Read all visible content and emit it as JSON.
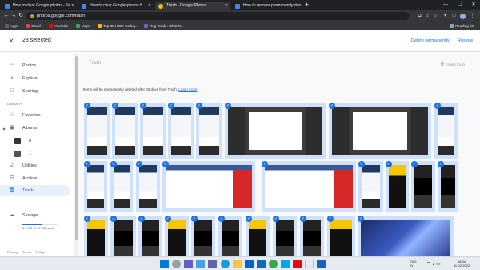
{
  "browser": {
    "tabs": [
      {
        "title": "How to clear Google photos - Ju",
        "color": "#4285f4"
      },
      {
        "title": "How to clear Google photos fr",
        "color": "#4285f4"
      },
      {
        "title": "Trash - Google Photos",
        "color": "#fbbc04"
      },
      {
        "title": "How to recover permanently de",
        "color": "#4285f4"
      }
    ],
    "url": "photos.google.com/trash",
    "bookmarks": [
      {
        "label": "Apps",
        "color": "#5f6368"
      },
      {
        "label": "Gmail",
        "color": "#ea4335"
      },
      {
        "label": "YouTube",
        "color": "#ff0000"
      },
      {
        "label": "Maps",
        "color": "#34a853"
      },
      {
        "label": "Top IBU BBA Colleg...",
        "color": "#ffb300"
      },
      {
        "label": "Rug Guide: What R...",
        "color": "#7e57c2"
      }
    ],
    "reading_list": "Reading list"
  },
  "header": {
    "selected_count": "28 selected",
    "delete_label": "Delete permanently",
    "restore_label": "Restore",
    "accent": "#1a73e8"
  },
  "sidebar": {
    "items": [
      {
        "label": "Photos",
        "icon": "photos-icon"
      },
      {
        "label": "Explore",
        "icon": "search-icon"
      },
      {
        "label": "Sharing",
        "icon": "people-icon"
      }
    ],
    "library_label": "LIBRARY",
    "library_items": [
      {
        "label": "Favorites",
        "icon": "star-icon"
      },
      {
        "label": "Albums",
        "icon": "album-icon"
      },
      {
        "label": "o"
      },
      {
        "label": "1"
      },
      {
        "label": "Utilities",
        "icon": "utilities-icon"
      },
      {
        "label": "Archive",
        "icon": "archive-icon"
      },
      {
        "label": "Trash",
        "icon": "trash-icon"
      }
    ],
    "storage_label": "Storage",
    "storage_text": "8.5 GB of 15 GB used",
    "storage_fraction": 0.57,
    "footer": [
      "Privacy",
      "Terms",
      "Policy"
    ]
  },
  "main": {
    "title": "Trash",
    "empty_trash": "Empty trash",
    "notice": "Items will be permanently deleted after 60 days from Trash.",
    "learn_more": "Learn more"
  },
  "taskbar": {
    "lang": "ENG",
    "lang2": "IN",
    "time": "18:04",
    "date": "11-02-2022"
  }
}
